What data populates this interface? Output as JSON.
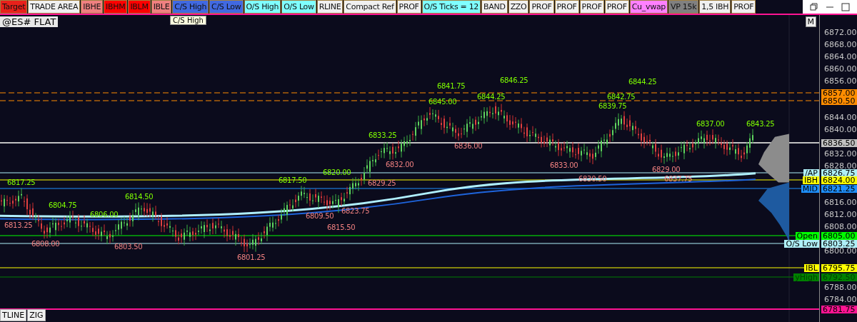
{
  "toolbar": {
    "buttons": [
      {
        "label": "Target",
        "color": "#e8211a"
      },
      {
        "label": "TRADE AREA",
        "color": "#f0f0f0"
      },
      {
        "label": "IBHE",
        "color": "#f08080"
      },
      {
        "label": "IBHM",
        "color": "#ff0000"
      },
      {
        "label": "IBLM",
        "color": "#ff0000"
      },
      {
        "label": "IBLE",
        "color": "#f08080"
      },
      {
        "label": "C/S High",
        "color": "#4169e1"
      },
      {
        "label": "C/S Low",
        "color": "#4169e1"
      },
      {
        "label": "O/S High",
        "color": "#7fffff"
      },
      {
        "label": "O/S Low",
        "color": "#7fffff"
      },
      {
        "label": "RLINE",
        "color": "#f0f0f0"
      },
      {
        "label": "Compact Ref",
        "color": "#f0f0f0"
      },
      {
        "label": "PROF",
        "color": "#f0f0f0"
      },
      {
        "label": "O/S Ticks = 12",
        "color": "#7fffff"
      },
      {
        "label": "BAND",
        "color": "#f0f0f0"
      },
      {
        "label": "ZZO",
        "color": "#f0f0f0"
      },
      {
        "label": "PROF",
        "color": "#f0f0f0"
      },
      {
        "label": "PROF",
        "color": "#f0f0f0"
      },
      {
        "label": "PROF",
        "color": "#f0f0f0"
      },
      {
        "label": "PROF",
        "color": "#f0f0f0"
      },
      {
        "label": "Cu_vwap",
        "color": "#ff80ff"
      },
      {
        "label": "VP 15k",
        "color": "#808080"
      },
      {
        "label": "1,5 IBH",
        "color": "#f0f0f0"
      },
      {
        "label": "PROF",
        "color": "#f0f0f0"
      }
    ]
  },
  "tooltip": "C/S High",
  "symbol": "@ES# FLAT",
  "chart_button": "M",
  "pivots": [
    {
      "text": "6813.25",
      "kind": "low"
    },
    {
      "text": "6817.25",
      "kind": "high"
    },
    {
      "text": "6808.00",
      "kind": "low"
    },
    {
      "text": "6804.75",
      "kind": "high"
    },
    {
      "text": "6806.00",
      "kind": "high"
    },
    {
      "text": "6803.50",
      "kind": "low"
    },
    {
      "text": "6814.50",
      "kind": "high"
    },
    {
      "text": "6801.25",
      "kind": "low"
    },
    {
      "text": "6817.50",
      "kind": "high"
    },
    {
      "text": "6809.50",
      "kind": "low"
    },
    {
      "text": "6820.00",
      "kind": "high"
    },
    {
      "text": "6815.50",
      "kind": "low"
    },
    {
      "text": "6823.75",
      "kind": "low"
    },
    {
      "text": "6829.25",
      "kind": "low"
    },
    {
      "text": "6833.25",
      "kind": "high"
    },
    {
      "text": "6832.00",
      "kind": "low"
    },
    {
      "text": "6845.00",
      "kind": "high"
    },
    {
      "text": "6841.75",
      "kind": "high"
    },
    {
      "text": "6836.00",
      "kind": "low"
    },
    {
      "text": "6844.25",
      "kind": "high"
    },
    {
      "text": "6846.25",
      "kind": "high"
    },
    {
      "text": "6833.00",
      "kind": "low"
    },
    {
      "text": "6830.50",
      "kind": "low"
    },
    {
      "text": "6839.75",
      "kind": "high"
    },
    {
      "text": "6842.75",
      "kind": "high"
    },
    {
      "text": "6844.25",
      "kind": "high"
    },
    {
      "text": "6829.00",
      "kind": "low"
    },
    {
      "text": "6837.75",
      "kind": "low"
    },
    {
      "text": "6837.00",
      "kind": "high"
    },
    {
      "text": "6843.25",
      "kind": "high"
    }
  ],
  "axis_ticks": [
    "6872.00",
    "6868.00",
    "6864.00",
    "6860.00",
    "6856.00",
    "6844.00",
    "6840.00",
    "6832.00",
    "6828.00",
    "6816.00",
    "6812.00",
    "6808.00",
    "6800.00",
    "6788.00",
    "6784.00"
  ],
  "levels": [
    {
      "value": "6857.00",
      "color": "#ff8c00"
    },
    {
      "value": "6850.50",
      "color": "#ff8c00"
    },
    {
      "value": "6836.50",
      "color": "#c0c0c0"
    },
    {
      "value": "6826.75",
      "color": "#aff0f8",
      "label": "/AP"
    },
    {
      "value": "6824.00",
      "color": "#ffff00",
      "label": "IBH"
    },
    {
      "value": "6821.25",
      "color": "#1e90ff",
      "label": "MID"
    },
    {
      "value": "6805.00",
      "color": "#00ff00",
      "label": "Open"
    },
    {
      "value": "6803.25",
      "color": "#aff0f8",
      "label": "O/S Low"
    },
    {
      "value": "6795.75",
      "color": "#ffff00",
      "label": "IBL"
    },
    {
      "value": "6792.50",
      "color": "#008000",
      "label": "yHigh"
    },
    {
      "value": "6781.75",
      "color": "#ff1493"
    }
  ],
  "bottom_buttons": [
    "TLINE",
    "ZIG"
  ]
}
